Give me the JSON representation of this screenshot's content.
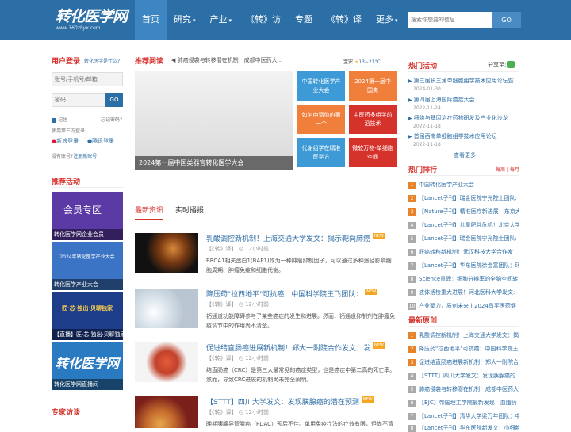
{
  "header": {
    "logo_main": "转化医学网",
    "logo_sub": "www.360zhyx.com",
    "nav": [
      "首页",
      "研究",
      "产业",
      "《转》访",
      "专题",
      "《转》译",
      "更多"
    ],
    "search_placeholder": "搜索你想要的信息",
    "search_button": "GO"
  },
  "login": {
    "title": "用户登录",
    "subtitle": "转化医学是什么?",
    "account_placeholder": "账号/手机号/邮箱",
    "password_placeholder": "密码",
    "go": "GO",
    "remember": "记住",
    "forgot": "忘记密码?",
    "third_party": "使用第三方登录",
    "sina": "新浪登录",
    "tencent": "腾讯登录",
    "no_account": "没有账号?",
    "register": "注册新账号"
  },
  "promos": {
    "title": "推荐活动",
    "items": [
      {
        "caption": "转化医学网企业会员",
        "banner": "会员专区"
      },
      {
        "caption": "转化医学产业大会",
        "banner": "2024年转化医学产业大会"
      },
      {
        "caption": "【直播】匠·芯·独出·贝聊独家",
        "banner": "匠·芯·独出·贝聊独家"
      },
      {
        "caption": "转化医学网直播间",
        "banner": "转化医学网"
      }
    ],
    "expert_title": "专家访谈"
  },
  "recommend": {
    "title": "推荐阅读",
    "ticker": "肺癌侵袭与转移潜在机制！成都中医药大...",
    "weather_city": "宝安",
    "weather_temp": "13~21°C",
    "hero_caption": "2024第一届中国类器官转化医学大会",
    "tiles": [
      {
        "label": "中国转化医学产业大会",
        "color": "#3d9ad6"
      },
      {
        "label": "2024第一届中国类",
        "color": "#f07f3c"
      },
      {
        "label": "如何申请你的第一个",
        "color": "#f07f3c"
      },
      {
        "label": "中医药多组学前沿技术",
        "color": "#d6322c"
      },
      {
        "label": "代谢组学在精准医学方",
        "color": "#3d9ad6"
      },
      {
        "label": "微软万物-单细胞空间",
        "color": "#d6322c"
      }
    ]
  },
  "news": {
    "tabs": [
      "最新资讯",
      "实时播报"
    ],
    "new_badge": "NEW",
    "articles": [
      {
        "title": "乳酸调控新机制！上海交通大学发文：揭示靶向肺癌",
        "source": "【《转》译】",
        "time": "12小时前",
        "desc": "BRCA1相关蛋白1(BAP1)作为一种肿瘤抑制因子，可以通过多种途径影响细胞周期、肿瘤免疫和细胞代谢。"
      },
      {
        "title": "降压药\"拉西地平\"可抗癌！中国科学院王飞团队：",
        "source": "【《转》译】",
        "time": "12小时前",
        "desc": "钙通道功能障碍参与了某些癌症的发生和进展。然而，钙通道抑制剂在肿瘤免疫调节中的作用尚不清楚。"
      },
      {
        "title": "促进结直肠癌进展新机制！郑大一附院合作发文：发",
        "source": "【《转》译】",
        "time": "12小时前",
        "desc": "结直肠癌（CRC）是第三大最常见的癌症类型，也是癌症中第二高的死亡率。然而，导致CRC进展的机制尚未完全阐明。"
      },
      {
        "title": "【STTT】四川大学发文：发现胰腺癌的潜在预测",
        "source": "【《转》译】",
        "time": "12小时前",
        "desc": "晚期胰腺导管腺癌（PDAC）预后不佳。单用免疫疗法的疗效有限，但尚不清"
      }
    ]
  },
  "hot_events": {
    "title": "热门活动",
    "share": "分享至:",
    "items": [
      {
        "title": "第三届长三角单细胞组学技术应用论坛暨",
        "date": "2024-01-30"
      },
      {
        "title": "第四届上海国际癌症大会",
        "date": "2022-11-24"
      },
      {
        "title": "细胞与基因治疗药物研发及产业化沙龙",
        "date": "2022-11-18"
      },
      {
        "title": "首届西南单细胞组学技术应用论坛",
        "date": "2022-11-18"
      }
    ],
    "more": "查看更多"
  },
  "ranking": {
    "title": "热门排行",
    "tabs": "每周 | 每月",
    "items": [
      "中国转化医学产业大会",
      "【Lancet子刊】瑞金医院宁光院士团队:",
      "【Nature子刊】精准医疗新进展：东京大",
      "【Lancet子刊】儿童肥胖危机！北京大学",
      "【Lancet子刊】瑞金医院宁光院士团队:",
      "肝癌转移新机制！武汉科技大学合作发",
      "【Lancet子刊】华东医院徐金富团队：环",
      "Science重磅：细胞分辨率的全脑空间转",
      "液体活检重大进展！河北医科大学发文:",
      "产业聚力，质创未来丨2024昌平医药健"
    ]
  },
  "latest": {
    "title": "最新原创",
    "items": [
      "乳酸调控新机制！上海交通大学发文：揭",
      "降压药\"拉西地平\"可抗癌！中国科学院王",
      "促进结直肠癌进展新机制！郑大一附院合",
      "【STTT】四川大学发文：发现胰腺癌的",
      "肺癌侵袭与转移潜在机制！成都中医药大",
      "【BJC】帝国理工学院最新发现：血脂药",
      "【Lancet子刊】清华大学梁万年团队：中",
      "【Lancet子刊】华东医院新发文：小细胞"
    ]
  }
}
